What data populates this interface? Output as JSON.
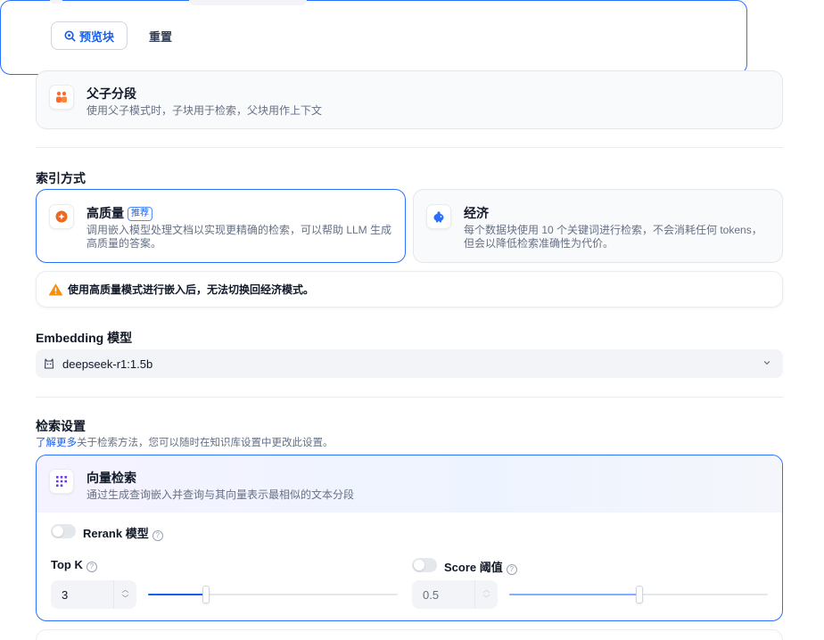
{
  "preview_block": {
    "preview_label": "预览块",
    "reset_label": "重置"
  },
  "parent_child": {
    "title": "父子分段",
    "description": "使用父子模式时，子块用于检索，父块用作上下文"
  },
  "index_method": {
    "section_title": "索引方式",
    "high_quality": {
      "title": "高质量",
      "badge": "推荐",
      "description_line1": "调用嵌入模型处理文档以实现更精确的检索，可以帮助 LLM 生成",
      "description_line2": "高质量的答案。"
    },
    "economy": {
      "title": "经济",
      "description_line1": "每个数据块使用 10 个关键词进行检索，不会消耗任何 tokens，",
      "description_line2": "但会以降低检索准确性为代价。"
    },
    "warning": "使用高质量模式进行嵌入后，无法切换回经济模式。"
  },
  "embedding": {
    "section_title": "Embedding 模型",
    "selected_model": "deepseek-r1:1.5b"
  },
  "retrieval": {
    "section_title": "检索设置",
    "learn_more": "了解更多",
    "learn_more_suffix": "关于检索方法，您可以随时在知识库设置中更改此设置。",
    "vector_search": {
      "title": "向量检索",
      "description": "通过生成查询嵌入并查询与其向量表示最相似的文本分段"
    },
    "rerank": {
      "label": "Rerank 模型",
      "enabled": false
    },
    "top_k": {
      "label": "Top K",
      "value": "3",
      "slider_fraction": 0.23
    },
    "score_threshold": {
      "label": "Score 阈值",
      "enabled": false,
      "value": "0.5",
      "slider_fraction": 0.5
    }
  },
  "colors": {
    "accent": "#155eef",
    "warning": "#f79009",
    "border_active": "#2970ff"
  }
}
